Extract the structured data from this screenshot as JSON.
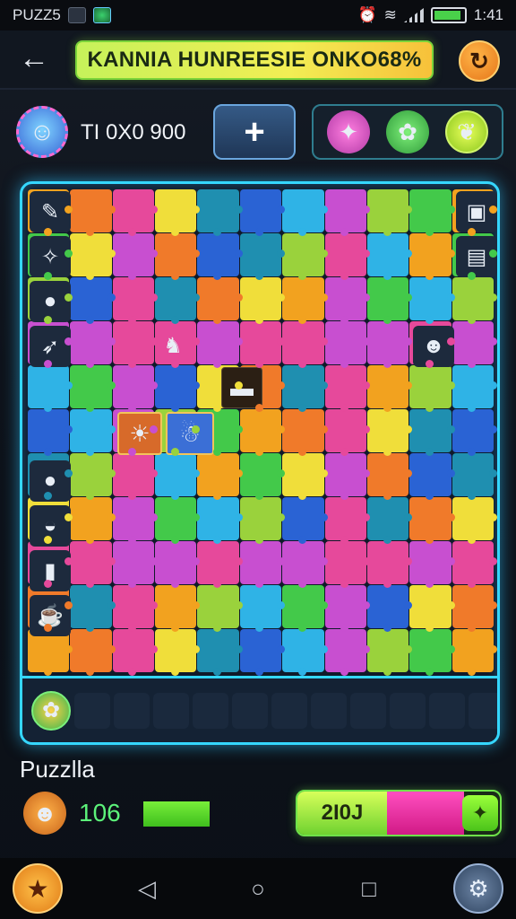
{
  "status_bar": {
    "app_name": "PUZZ5",
    "time": "1:41"
  },
  "header": {
    "back_icon": "arrow-left-icon",
    "title": "KANNIA HUNREESIE ONKO68%",
    "refresh_icon": "refresh-icon"
  },
  "profile": {
    "score_text": "TI 0X0 900",
    "add_label": "+"
  },
  "board": {
    "palette": [
      "#f2a21f",
      "#f0de3a",
      "#2fb3e6",
      "#43c94a",
      "#e6499b",
      "#2a63d4",
      "#9ad23c",
      "#f07a2a",
      "#1f8fb0",
      "#c84fd0"
    ],
    "tray_slots": 11
  },
  "bottom": {
    "label": "Puzzlla",
    "count": "106",
    "progress": 1.0,
    "meter_value": "2I0J"
  }
}
